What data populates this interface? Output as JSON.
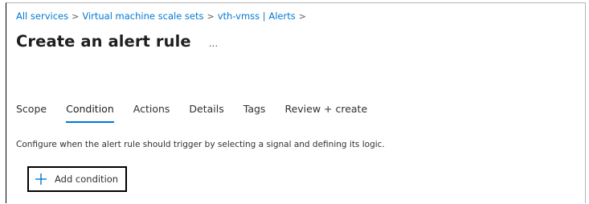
{
  "breadcrumb": {
    "items": [
      "All services",
      "Virtual machine scale sets",
      "vth-vmss | Alerts"
    ],
    "separator": ">"
  },
  "header": {
    "title": "Create an alert rule",
    "more_label": "..."
  },
  "tabs": [
    {
      "label": "Scope",
      "selected": false
    },
    {
      "label": "Condition",
      "selected": true
    },
    {
      "label": "Actions",
      "selected": false
    },
    {
      "label": "Details",
      "selected": false
    },
    {
      "label": "Tags",
      "selected": false
    },
    {
      "label": "Review + create",
      "selected": false
    }
  ],
  "condition": {
    "description": "Configure when the alert rule should trigger by selecting a signal and defining its logic.",
    "add_button_label": "Add condition",
    "add_button_icon": "plus-icon"
  },
  "colors": {
    "link": "#0078d4",
    "selected_tab_underline": "#0078d4",
    "text": "#323130",
    "button_border": "#000000"
  }
}
